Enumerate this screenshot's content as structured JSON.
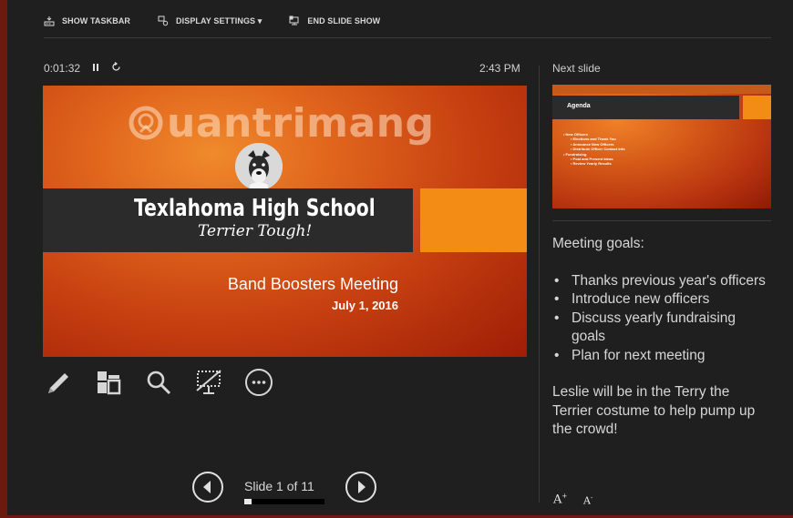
{
  "toolbar": {
    "show_taskbar": "SHOW TASKBAR",
    "display_settings": "DISPLAY SETTINGS ▾",
    "end_slide_show": "END SLIDE SHOW"
  },
  "timer": {
    "elapsed": "0:01:32",
    "clock": "2:43 PM"
  },
  "current_slide": {
    "watermark": "uantrimang",
    "title": "Texlahoma High School",
    "tagline": "Terrier Tough!",
    "subtitle": "Band Boosters Meeting",
    "date": "July 1, 2016"
  },
  "tools": [
    "pen-icon",
    "see-all-slides-icon",
    "zoom-icon",
    "black-screen-icon",
    "more-options-icon"
  ],
  "navigation": {
    "slide_counter": "Slide 1 of 11",
    "progress_fraction": 0.09
  },
  "next_slide": {
    "label": "Next slide",
    "title": "Agenda",
    "bullets": [
      {
        "level": 1,
        "text": "New Officers"
      },
      {
        "level": 2,
        "text": "Elections and Thank You"
      },
      {
        "level": 2,
        "text": "Announce New Officers"
      },
      {
        "level": 2,
        "text": "Distribute Officer Contact Info"
      },
      {
        "level": 1,
        "text": "Fundraising"
      },
      {
        "level": 2,
        "text": "Post and Present Ideas"
      },
      {
        "level": 2,
        "text": "Review Yearly Results"
      }
    ]
  },
  "notes": {
    "heading": "Meeting goals:",
    "items": [
      "Thanks previous year's officers",
      "Introduce new officers",
      "Discuss yearly fundraising goals",
      "Plan for next meeting"
    ],
    "footer": "Leslie will be in the Terry the Terrier costume to help pump up the crowd!"
  },
  "font_controls": {
    "increase": "A",
    "decrease": "A"
  },
  "colors": {
    "accent_orange": "#f28c15",
    "banner_dark": "#2b2b2b",
    "slide_red": "#c53f10",
    "background": "#1f1f1f"
  }
}
